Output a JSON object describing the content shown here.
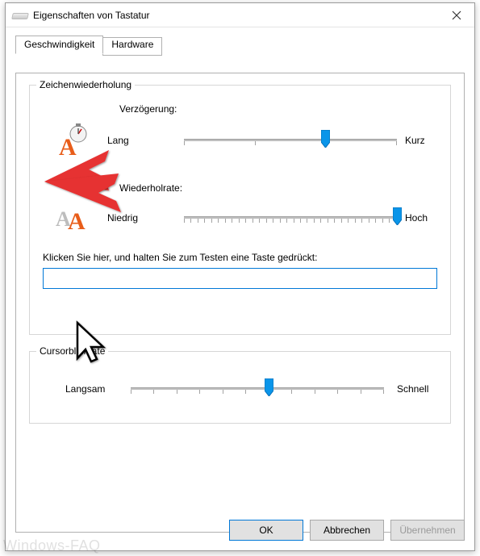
{
  "window": {
    "title": "Eigenschaften von Tastatur"
  },
  "tabs": {
    "speed": "Geschwindigkeit",
    "hardware": "Hardware"
  },
  "repeat": {
    "group_title": "Zeichenwiederholung",
    "delay_label": "Verzögerung:",
    "delay_min": "Lang",
    "delay_max": "Kurz",
    "delay_value": 2,
    "delay_ticks": 4,
    "rate_label": "Wiederholrate:",
    "rate_min": "Niedrig",
    "rate_max": "Hoch",
    "rate_value": 31,
    "rate_ticks": 32,
    "test_label": "Klicken Sie hier, und halten Sie zum Testen eine Taste gedrückt:",
    "test_value": ""
  },
  "blink": {
    "group_title": "Cursorblinkrate",
    "min": "Langsam",
    "max": "Schnell",
    "value": 6,
    "ticks": 12
  },
  "buttons": {
    "ok": "OK",
    "cancel": "Abbrechen",
    "apply": "Übernehmen"
  },
  "watermark": "Windows-FAQ"
}
